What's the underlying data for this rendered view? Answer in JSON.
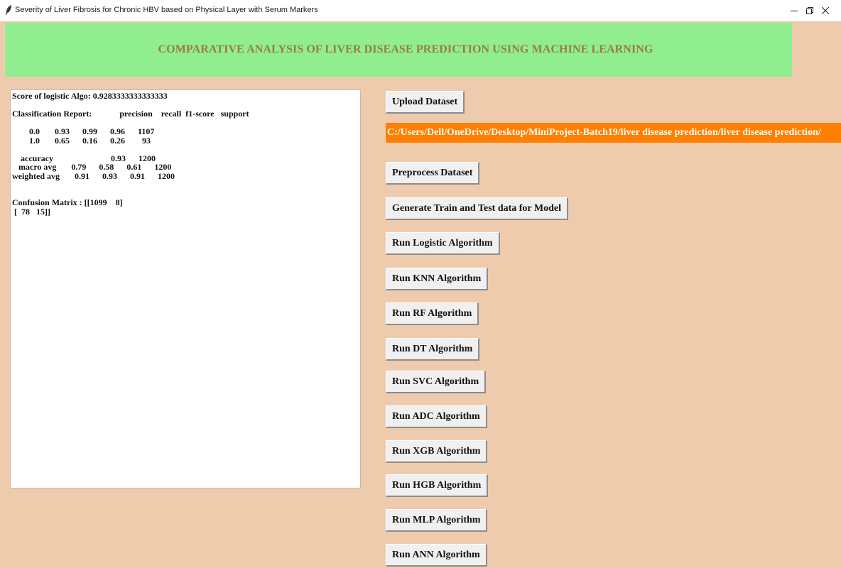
{
  "window": {
    "title": "Severity of Liver Fibrosis for Chronic HBV based on Physical Layer with Serum Markers",
    "app_icon": "feather-icon",
    "controls": [
      "minimize-icon",
      "restore-icon",
      "close-icon"
    ]
  },
  "header": {
    "title": "COMPARATIVE ANALYSIS OF LIVER DISEASE PREDICTION USING MACHINE LEARNING"
  },
  "output": {
    "text": "Score of logistic Algo: 0.9283333333333333\n\nClassification Report:             precision    recall  f1-score   support\n\n        0.0       0.93      0.99      0.96      1107\n        1.0       0.65      0.16      0.26        93\n\n    accuracy                           0.93      1200\n   macro avg       0.79      0.58      0.61      1200\nweighted avg       0.91      0.93      0.91      1200\n\n\nConfusion Matrix : [[1099    8]\n [  78   15]]"
  },
  "controls": {
    "upload_label": "Upload Dataset",
    "dataset_path": "C:/Users/Dell/OneDrive/Desktop/MiniProject-Batch19/liver disease prediction/liver disease prediction/",
    "preprocess_label": "Preprocess Dataset",
    "split_label": "Generate Train and Test data for Model",
    "logistic_label": "Run Logistic Algorithm",
    "knn_label": "Run KNN Algorithm",
    "rf_label": "Run RF Algorithm",
    "dt_label": "Run DT Algorithm",
    "svc_label": "Run SVC Algorithm",
    "adc_label": "Run ADC Algorithm",
    "xgb_label": "Run XGB Algorithm",
    "hgb_label": "Run HGB Algorithm",
    "mlp_label": "Run MLP Algorithm",
    "ann_label": "Run ANN Algorithm"
  },
  "colors": {
    "background": "#eecbad",
    "header": "#90ee90",
    "header_text": "#9a7b3f",
    "path_bg": "#ff7f00",
    "path_text": "#ffffff"
  }
}
